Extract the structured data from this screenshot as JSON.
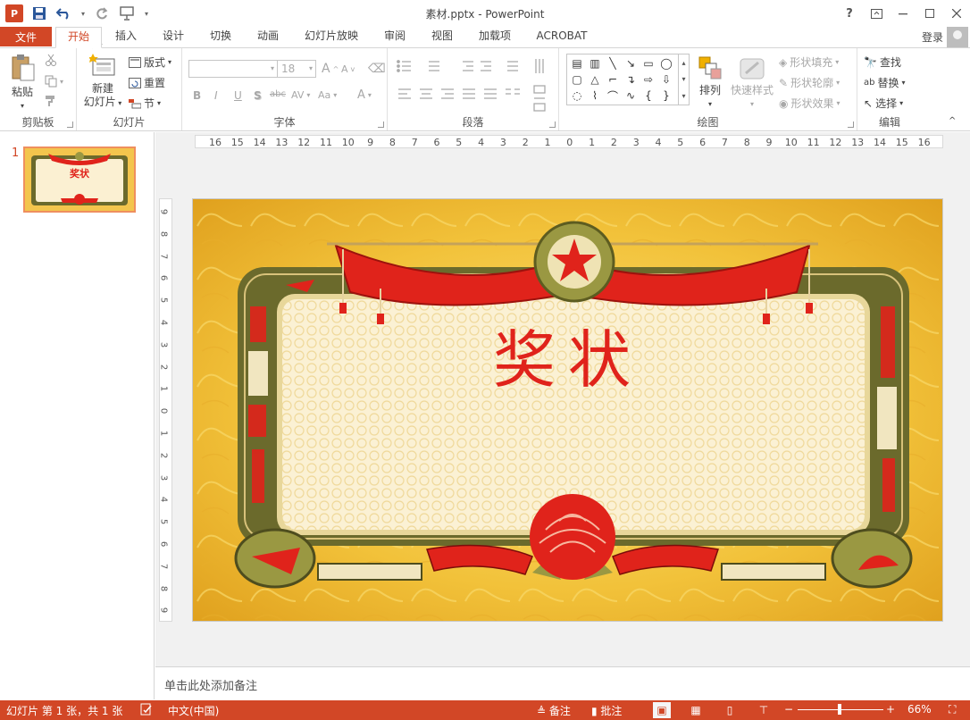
{
  "window": {
    "title": "素材.pptx - PowerPoint",
    "help": "?",
    "login": "登录"
  },
  "tabs": {
    "file": "文件",
    "home": "开始",
    "insert": "插入",
    "design": "设计",
    "transitions": "切换",
    "animations": "动画",
    "slideshow": "幻灯片放映",
    "review": "审阅",
    "view": "视图",
    "addins": "加载项",
    "acrobat": "ACROBAT"
  },
  "ribbon": {
    "clipboard": {
      "label": "剪贴板",
      "paste": "粘贴"
    },
    "slides": {
      "label": "幻灯片",
      "new_line1": "新建",
      "new_line2": "幻灯片",
      "layout": "版式",
      "reset": "重置",
      "section": "节"
    },
    "font": {
      "label": "字体",
      "size": "18",
      "bold": "B",
      "italic": "I",
      "underline": "U",
      "shadow": "S",
      "strike": "abc",
      "spacing": "AV",
      "case": "Aa",
      "grow": "A",
      "shrink": "A",
      "color": "A"
    },
    "paragraph": {
      "label": "段落"
    },
    "drawing": {
      "label": "绘图",
      "arrange": "排列",
      "quick_styles": "快速样式",
      "fill": "形状填充",
      "outline": "形状轮廓",
      "effects": "形状效果"
    },
    "editing": {
      "label": "编辑",
      "find": "查找",
      "replace": "替换",
      "select": "选择"
    }
  },
  "thumbnail": {
    "number": "1",
    "title": "奖状"
  },
  "ruler": {
    "h": [
      "16",
      "15",
      "14",
      "13",
      "12",
      "11",
      "10",
      "9",
      "8",
      "7",
      "6",
      "5",
      "4",
      "3",
      "2",
      "1",
      "0",
      "1",
      "2",
      "3",
      "4",
      "5",
      "6",
      "7",
      "8",
      "9",
      "10",
      "11",
      "12",
      "13",
      "14",
      "15",
      "16"
    ],
    "v": [
      "9",
      "8",
      "7",
      "6",
      "5",
      "4",
      "3",
      "2",
      "1",
      "0",
      "1",
      "2",
      "3",
      "4",
      "5",
      "6",
      "7",
      "8",
      "9"
    ]
  },
  "slide": {
    "title": "奖状"
  },
  "notes": {
    "placeholder": "单击此处添加备注"
  },
  "status": {
    "slide_info": "幻灯片 第 1 张，共 1 张",
    "language": "中文(中国)",
    "notes": "备注",
    "comments": "批注",
    "zoom": "66%"
  },
  "colors": {
    "accent": "#d24726",
    "gold": "#f1c53c",
    "red": "#e0231b",
    "olive": "#6b6a2c"
  }
}
